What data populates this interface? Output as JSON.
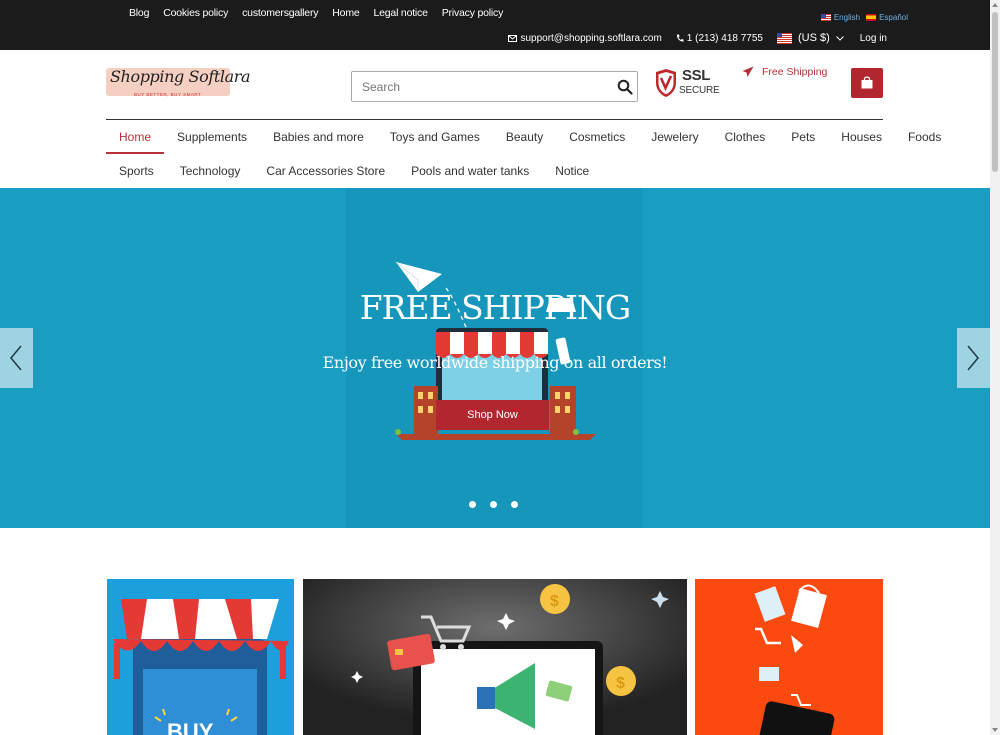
{
  "topbar": {
    "links": [
      "Blog",
      "Cookies policy",
      "customersgallery",
      "Home",
      "Legal notice",
      "Privacy policy"
    ],
    "languages": [
      {
        "label": "English",
        "flag": "us-flag-icon"
      },
      {
        "label": "Español",
        "flag": "es-flag-icon"
      }
    ],
    "email": "support@shopping.softlara.com",
    "phone": "1 (213) 418 7755",
    "currency": "(US $)",
    "login": "Log in"
  },
  "header": {
    "logo_text": "Shopping Softlara",
    "logo_tagline": "BUY BETTER, BUY SMART",
    "search_placeholder": "Search",
    "ssl_line1": "SSL",
    "ssl_line2": "SECURE",
    "free_shipping": "Free Shipping"
  },
  "nav": {
    "row1": [
      "Home",
      "Supplements",
      "Babies and more",
      "Toys and Games",
      "Beauty",
      "Cosmetics",
      "Jewelery",
      "Clothes",
      "Pets",
      "Houses",
      "Foods"
    ],
    "row2": [
      "Sports",
      "Technology",
      "Car Accessories Store",
      "Pools and water tanks",
      "Notice"
    ],
    "active": "Home"
  },
  "hero": {
    "title": "FREE SHIPPING",
    "subtitle": "Enjoy free worldwide shipping on all orders!",
    "button": "Shop Now",
    "slides": 3
  },
  "colors": {
    "brand_red": "#b2272f",
    "hero_blue": "#199ec1",
    "topbar": "#1b1b1b"
  }
}
